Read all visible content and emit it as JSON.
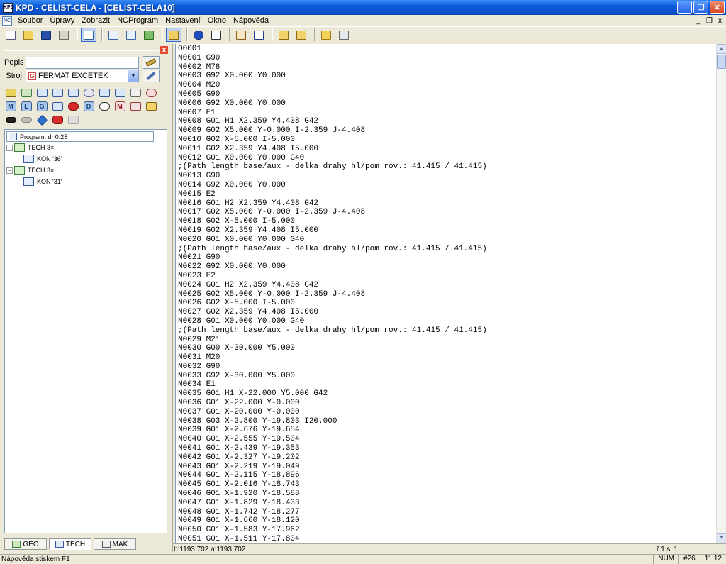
{
  "window": {
    "title": "KPD - CELIST-CELA - [CELIST-CELA10]",
    "app_badge": "KPD",
    "minimize_glyph": "_",
    "maximize_glyph": "❐",
    "close_glyph": "✕"
  },
  "menubar": {
    "doc_badge": "NC",
    "items": [
      "Soubor",
      "Úpravy",
      "Zobrazit",
      "NCProgram",
      "Nastavení",
      "Okno",
      "Nápověda"
    ],
    "mdi_minimize": "_",
    "mdi_restore": "❐",
    "mdi_close": "x"
  },
  "panel": {
    "close_glyph": "x",
    "popis_label": "Popis",
    "stroj_label": "Stroj",
    "popis_value": "",
    "stroj_value": "FERMAT EXCETEK",
    "stroj_icon_letter": "G",
    "letter_icons": [
      "M",
      "L",
      "G",
      "D",
      "M"
    ],
    "tree": {
      "root_label": "Program, d=0.25",
      "items": [
        {
          "label": "TECH 3×",
          "child": "KON '36'"
        },
        {
          "label": "TECH 3×",
          "child": "KON '31'"
        }
      ]
    },
    "tabs": [
      "GEO",
      "TECH",
      "MAK"
    ]
  },
  "editor": {
    "lines": [
      "O0001",
      "N0001 G90",
      "N0002 M78",
      "N0003 G92 X0.000 Y0.000",
      "N0004 M20",
      "N0005 G90",
      "N0006 G92 X0.000 Y0.000",
      "N0007 E1",
      "N0008 G01 H1 X2.359 Y4.408 G42",
      "N0009 G02 X5.000 Y-0.000 I-2.359 J-4.408",
      "N0010 G02 X-5.000 I-5.000",
      "N0011 G02 X2.359 Y4.408 I5.000",
      "N0012 G01 X0.000 Y0.000 G40",
      ";(Path length base/aux - delka drahy hl/pom rov.: 41.415 / 41.415)",
      "N0013 G90",
      "N0014 G92 X0.000 Y0.000",
      "N0015 E2",
      "N0016 G01 H2 X2.359 Y4.408 G42",
      "N0017 G02 X5.000 Y-0.000 I-2.359 J-4.408",
      "N0018 G02 X-5.000 I-5.000",
      "N0019 G02 X2.359 Y4.408 I5.000",
      "N0020 G01 X0.000 Y0.000 G40",
      ";(Path length base/aux - delka drahy hl/pom rov.: 41.415 / 41.415)",
      "N0021 G90",
      "N0022 G92 X0.000 Y0.000",
      "N0023 E2",
      "N0024 G01 H2 X2.359 Y4.408 G42",
      "N0025 G02 X5.000 Y-0.000 I-2.359 J-4.408",
      "N0026 G02 X-5.000 I-5.000",
      "N0027 G02 X2.359 Y4.408 I5.000",
      "N0028 G01 X0.000 Y0.000 G40",
      ";(Path length base/aux - delka drahy hl/pom rov.: 41.415 / 41.415)",
      "N0029 M21",
      "N0030 G00 X-30.000 Y5.000",
      "N0031 M20",
      "N0032 G90",
      "N0033 G92 X-30.000 Y5.000",
      "N0034 E1",
      "N0035 G01 H1 X-22.000 Y5.000 G42",
      "N0036 G01 X-22.000 Y-0.000",
      "N0037 G01 X-20.000 Y-0.000",
      "N0038 G03 X-2.800 Y-19.803 I20.000",
      "N0039 G01 X-2.676 Y-19.654",
      "N0040 G01 X-2.555 Y-19.504",
      "N0041 G01 X-2.439 Y-19.353",
      "N0042 G01 X-2.327 Y-19.202",
      "N0043 G01 X-2.219 Y-19.049",
      "N0044 G01 X-2.115 Y-18.896",
      "N0045 G01 X-2.016 Y-18.743",
      "N0046 G01 X-1.920 Y-18.588",
      "N0047 G01 X-1.829 Y-18.433",
      "N0048 G01 X-1.742 Y-18.277",
      "N0049 G01 X-1.660 Y-18.120",
      "N0050 G01 X-1.583 Y-17.962",
      "N0051 G01 X-1.511 Y-17.804"
    ]
  },
  "infobar": {
    "length": "b:1193.702 a:1193.702",
    "position": "ř 1 sl 1"
  },
  "statusbar": {
    "hint": "Nápověda stiskem F1",
    "num": "NUM",
    "line_no": "#26",
    "time": "11:12"
  }
}
